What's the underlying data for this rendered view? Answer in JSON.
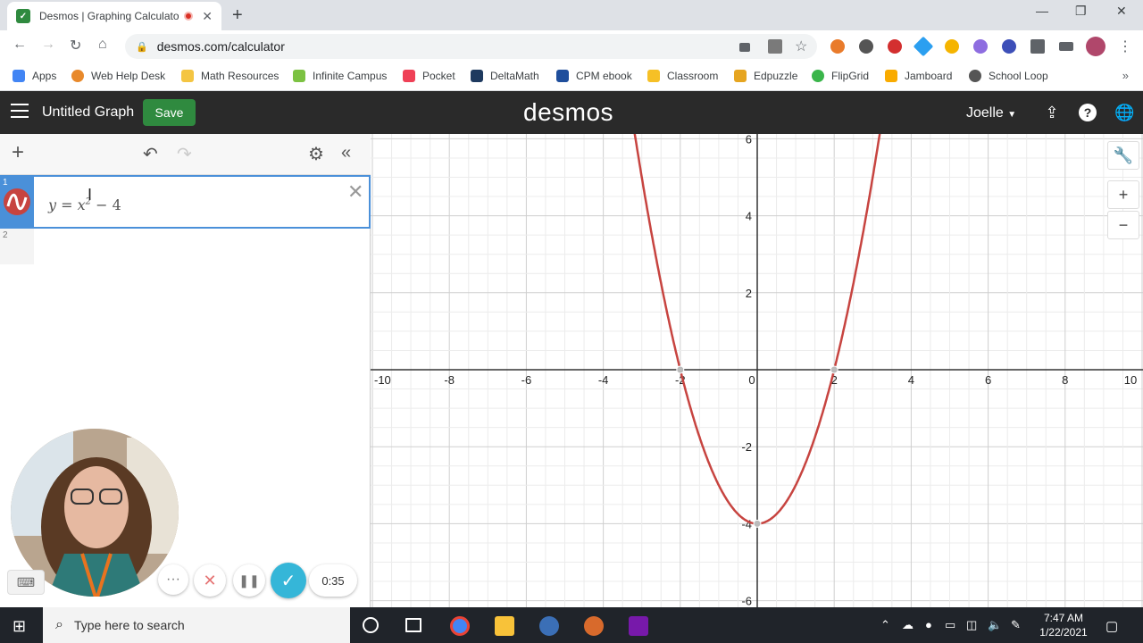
{
  "browser": {
    "tab_title": "Desmos | Graphing Calculator",
    "url": "desmos.com/calculator",
    "bookmarks": [
      "Apps",
      "Web Help Desk",
      "Math Resources",
      "Infinite Campus",
      "Pocket",
      "DeltaMath",
      "CPM ebook",
      "Classroom",
      "Edpuzzle",
      "FlipGrid",
      "Jamboard",
      "School Loop"
    ]
  },
  "desmos": {
    "graph_title": "Untitled Graph",
    "save_label": "Save",
    "logo": "desmos",
    "user": "Joelle",
    "expressions": [
      {
        "index": "1",
        "lhs": "y = x",
        "exp": "2",
        "rhs": " − 4",
        "color": "#c74440"
      },
      {
        "index": "2"
      }
    ]
  },
  "recorder": {
    "timer": "0:35"
  },
  "chart_data": {
    "type": "line",
    "function": "y = x^2 - 4",
    "xlim": [
      -10,
      10
    ],
    "ylim": [
      -6,
      6
    ],
    "x_ticks": [
      "-10",
      "-8",
      "-6",
      "-4",
      "-2",
      "0",
      "2",
      "4",
      "6",
      "8",
      "10"
    ],
    "y_ticks": [
      "6",
      "4",
      "2",
      "-2",
      "-4",
      "-6"
    ],
    "grid": true,
    "points": [
      [
        -2,
        0
      ],
      [
        2,
        0
      ],
      [
        0,
        -4
      ]
    ],
    "color": "#c74440"
  },
  "taskbar": {
    "search_placeholder": "Type here to search",
    "time": "7:47 AM",
    "date": "1/22/2021"
  }
}
